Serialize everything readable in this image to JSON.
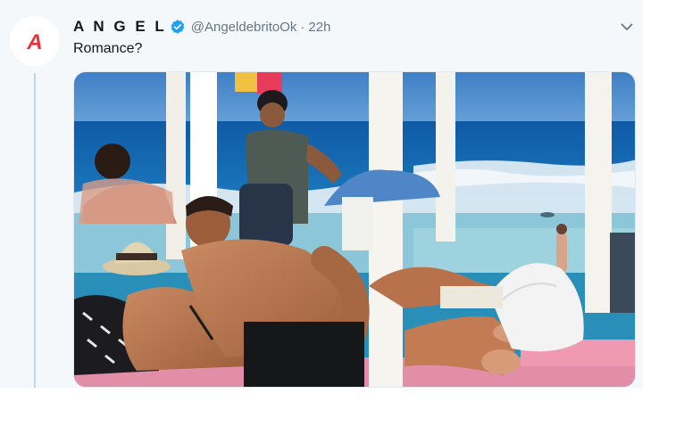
{
  "tweet": {
    "display_name": "A N G E L",
    "handle": "@AngeldebritoOk",
    "separator": "·",
    "time": "22h",
    "text": "Romance?",
    "avatar_letter": "A"
  },
  "icons": {
    "avatar": "brand-logo-icon",
    "verified": "verified-badge-icon",
    "menu": "chevron-down-icon"
  },
  "colors": {
    "brand_red": "#e8333f",
    "verified_blue": "#1da1f2",
    "text_primary": "#14171a",
    "text_secondary": "#657786",
    "card_background": "#f5f8fa"
  }
}
